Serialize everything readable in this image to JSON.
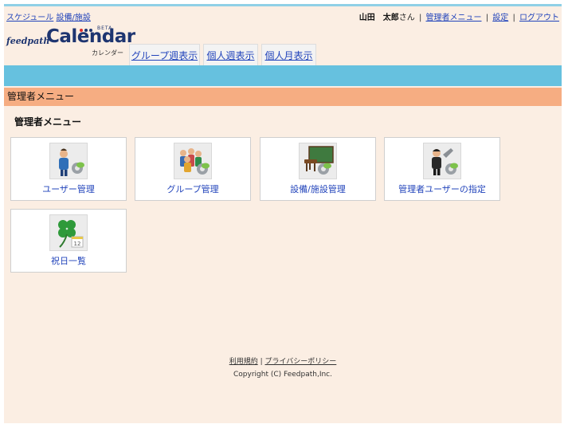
{
  "topbar": {
    "left_links": [
      "スケジュール",
      "設備/施設"
    ],
    "user_name": "山田　太郎",
    "user_suffix": "さん",
    "admin_menu": "管理者メニュー",
    "settings": "設定",
    "logout": "ログアウト"
  },
  "logo": {
    "prefix": "feedpath",
    "name": "Calendar",
    "beta": "BETA",
    "kana": "カレンダー"
  },
  "tabs": [
    "グループ週表示",
    "個人週表示",
    "個人月表示"
  ],
  "section_bar": "管理者メニュー",
  "section_title": "管理者メニュー",
  "cards": [
    {
      "label": "ユーザー管理",
      "icon": "user-admin-icon"
    },
    {
      "label": "グループ管理",
      "icon": "group-admin-icon"
    },
    {
      "label": "設備/施設管理",
      "icon": "facility-admin-icon"
    },
    {
      "label": "管理者ユーザーの指定",
      "icon": "admin-user-icon"
    },
    {
      "label": "祝日一覧",
      "icon": "holiday-clover-icon"
    }
  ],
  "footer": {
    "terms": "利用規約",
    "privacy": "プライバシーポリシー",
    "copyright": "Copyright (C) Feedpath,Inc."
  },
  "colors": {
    "background": "#fbeee3",
    "blue_bar": "#66c1df",
    "orange_bar": "#f6ad82",
    "link": "#2244bb"
  }
}
